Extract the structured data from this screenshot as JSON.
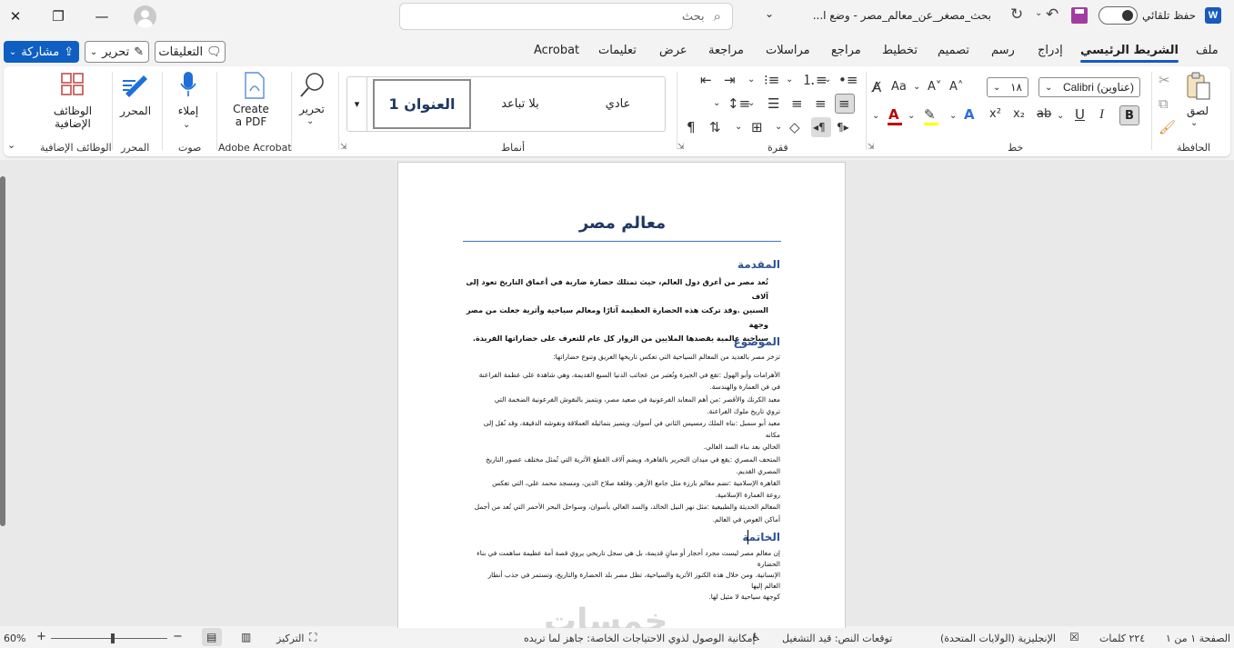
{
  "titlebar": {
    "search_placeholder": "بحث",
    "doc_title": "بحث_مصغر_عن_معالم_مصر  -  وضع ا...",
    "autosave_label": "حفظ تلقائي",
    "app_logo": "W"
  },
  "menu": {
    "share_label": "مشاركة",
    "edit_label": "تحرير",
    "comments_label": "التعليقات",
    "tabs": [
      "ملف",
      "الشريط الرئيسي",
      "إدراج",
      "رسم",
      "تصميم",
      "تخطيط",
      "مراجع",
      "مراسلات",
      "مراجعة",
      "عرض",
      "تعليمات",
      "Acrobat"
    ],
    "active_tab": "الشريط الرئيسي"
  },
  "ribbon": {
    "groups": {
      "clipboard": "الحافظة",
      "font": "خط",
      "paragraph": "فقرة",
      "styles": "أنماط",
      "adobe": "Adobe Acrobat",
      "voice": "صوت",
      "editor": "المحرر",
      "addins": "الوظائف الإضافية"
    },
    "paste_label": "لصق",
    "font_name": "Calibri (عناوين)",
    "font_size": "١٨",
    "styles": [
      "عادي",
      "بلا تباعد",
      "العنوان 1"
    ],
    "selected_style": "العنوان 1",
    "editing_label": "تحرير",
    "create_pdf_line1": "Create",
    "create_pdf_line2": "a PDF",
    "dictate_label": "إملاء",
    "editor_label": "المحرر",
    "addins_line1": "الوظائف",
    "addins_line2": "الإضافية"
  },
  "document": {
    "title": "معالم مصر",
    "intro_heading": "المقدمة",
    "intro_lines": [
      "تُعد مصر من أعرق دول العالم، حيث تمتلك حضارة ضاربة في أعماق التاريخ تعود إلى آلاف",
      "السنين .وقد تركت هذه الحضارة العظيمة آثارًا ومعالم سياحية وأثرية جعلت من مصر وجهة",
      "سياحية عالمية يقصدها الملايين من الزوار كل عام للتعرف على حضاراتها الفريدة."
    ],
    "topic_heading": "الموضوع",
    "topic_lines": [
      "تزخر مصر بالعديد من المعالم السياحية التي تعكس تاريخها العريق وتنوع حضاراتها:",
      "",
      "الأهرامات وأبو الهول :تقع في الجيزة وتُعتبر من عجائب الدنيا السبع القديمة، وهي شاهدة على عظمة الفراعنة",
      "في فن العمارة والهندسة.",
      "معبد الكرنك والأقصر :من أهم المعابد الفرعونية في صعيد مصر، ويتميز بالنقوش الفرعونية الضخمة التي",
      "تروي تاريخ ملوك الفراعنة.",
      "معبد أبو سمبل :بناه الملك رمسيس الثاني في أسوان، ويتميز بتماثيله العملاقة ونقوشه الدقيقة، وقد نُقل إلى مكانه",
      "الحالي بعد بناء السد العالي.",
      "المتحف المصري :يقع في ميدان التحرير بالقاهرة، ويضم آلاف القطع الأثرية التي تُمثل مختلف عصور التاريخ",
      "المصري القديم.",
      "القاهرة الإسلامية :تضم معالم بارزة مثل جامع الأزهر، وقلعة صلاح الدين، ومسجد محمد علي، التي تعكس",
      "روعة العمارة الإسلامية.",
      "المعالم الحديثة والطبيعية :مثل نهر النيل الخالد، والسد العالي بأسوان، وسواحل البحر الأحمر التي تُعد من أجمل",
      "أماكن الغوص في العالم."
    ],
    "conclusion_heading": "الخاتمة",
    "conclusion_lines": [
      "إن معالم مصر ليست مجرد أحجار أو مبانٍ قديمة، بل هي سجل تاريخي يروي قصة أمة عظيمة ساهمت في بناء الحضارة",
      "الإنسانية. ومن خلال هذه الكنوز الأثرية والسياحية، تظل مصر بلد الحضارة والتاريخ، وتستمر في جذب أنظار العالم إليها",
      "كوجهة سياحية لا مثيل لها."
    ]
  },
  "watermark": "خمسات",
  "statusbar": {
    "page": "الصفحة ١ من ١",
    "words": "٢٢٤ كلمات",
    "language": "الإنجليزية (الولايات المتحدة)",
    "predictions": "توقعات النص: قيد التشغيل",
    "accessibility": "إمكانية الوصول لذوي الاحتياجات الخاصة: جاهز لما تريده",
    "focus": "التركيز",
    "zoom": "60%"
  },
  "colors": {
    "accent": "#185abd",
    "heading": "#2f5496",
    "title": "#1f3864",
    "save_icon": "#a33ba1"
  }
}
